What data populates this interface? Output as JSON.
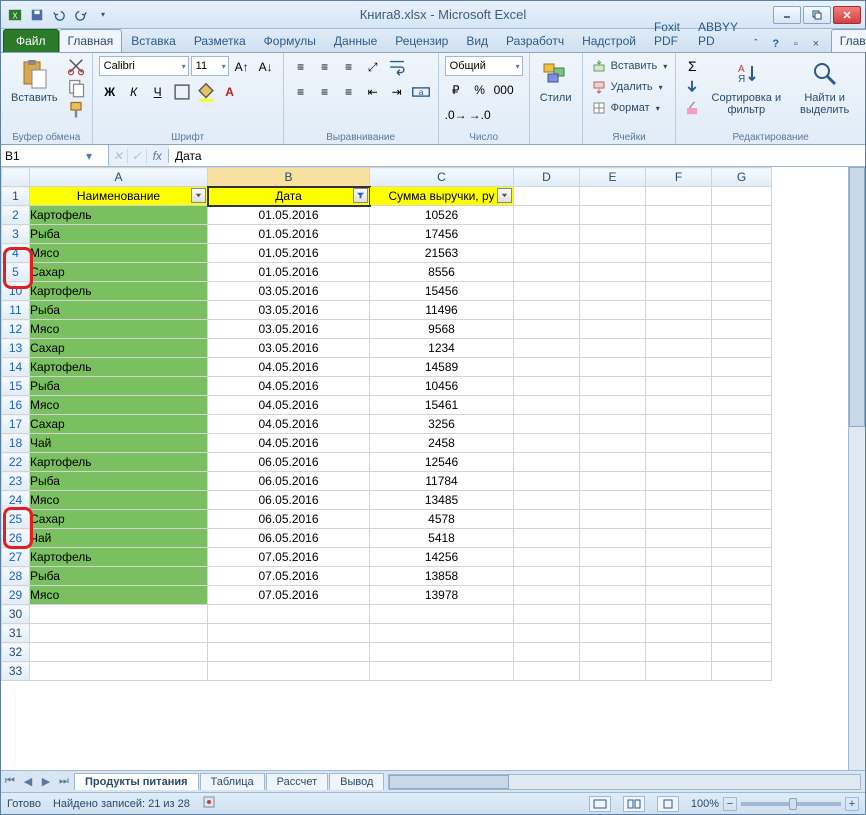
{
  "window": {
    "title": "Книга8.xlsx - Microsoft Excel"
  },
  "tabs": {
    "file": "Файл",
    "items": [
      "Главная",
      "Вставка",
      "Разметка",
      "Формулы",
      "Данные",
      "Рецензир",
      "Вид",
      "Разработч",
      "Надстрой",
      "Foxit PDF",
      "ABBYY PD"
    ],
    "active": 0
  },
  "ribbon": {
    "clipboard": {
      "paste": "Вставить",
      "label": "Буфер обмена"
    },
    "font": {
      "name": "Calibri",
      "size": "11",
      "label": "Шрифт"
    },
    "align": {
      "label": "Выравнивание"
    },
    "number": {
      "format": "Общий",
      "label": "Число"
    },
    "styles": {
      "btn": "Стили",
      "label": ""
    },
    "cells": {
      "insert": "Вставить",
      "delete": "Удалить",
      "format": "Формат",
      "label": "Ячейки"
    },
    "editing": {
      "sort": "Сортировка и фильтр",
      "find": "Найти и выделить",
      "label": "Редактирование"
    }
  },
  "namebox": "B1",
  "formula": "Дата",
  "columns": {
    "A": 178,
    "B": 162,
    "C": 144,
    "D": 66,
    "E": 66,
    "F": 66,
    "G": 66
  },
  "headers": {
    "A": "Наименование",
    "B": "Дата",
    "C": "Сумма выручки, ру"
  },
  "rows": [
    {
      "n": 2,
      "a": "Картофель",
      "b": "01.05.2016",
      "c": "10526"
    },
    {
      "n": 3,
      "a": "Рыба",
      "b": "01.05.2016",
      "c": "17456"
    },
    {
      "n": 4,
      "a": "Мясо",
      "b": "01.05.2016",
      "c": "21563"
    },
    {
      "n": 5,
      "a": "Сахар",
      "b": "01.05.2016",
      "c": "8556"
    },
    {
      "n": 10,
      "a": "Картофель",
      "b": "03.05.2016",
      "c": "15456"
    },
    {
      "n": 11,
      "a": "Рыба",
      "b": "03.05.2016",
      "c": "11496"
    },
    {
      "n": 12,
      "a": "Мясо",
      "b": "03.05.2016",
      "c": "9568"
    },
    {
      "n": 13,
      "a": "Сахар",
      "b": "03.05.2016",
      "c": "1234"
    },
    {
      "n": 14,
      "a": "Картофель",
      "b": "04.05.2016",
      "c": "14589"
    },
    {
      "n": 15,
      "a": "Рыба",
      "b": "04.05.2016",
      "c": "10456"
    },
    {
      "n": 16,
      "a": "Мясо",
      "b": "04.05.2016",
      "c": "15461"
    },
    {
      "n": 17,
      "a": "Сахар",
      "b": "04.05.2016",
      "c": "3256"
    },
    {
      "n": 18,
      "a": "Чай",
      "b": "04.05.2016",
      "c": "2458"
    },
    {
      "n": 22,
      "a": "Картофель",
      "b": "06.05.2016",
      "c": "12546"
    },
    {
      "n": 23,
      "a": "Рыба",
      "b": "06.05.2016",
      "c": "11784"
    },
    {
      "n": 24,
      "a": "Мясо",
      "b": "06.05.2016",
      "c": "13485"
    },
    {
      "n": 25,
      "a": "Сахар",
      "b": "06.05.2016",
      "c": "4578"
    },
    {
      "n": 26,
      "a": "Чай",
      "b": "06.05.2016",
      "c": "5418"
    },
    {
      "n": 27,
      "a": "Картофель",
      "b": "07.05.2016",
      "c": "14256"
    },
    {
      "n": 28,
      "a": "Рыба",
      "b": "07.05.2016",
      "c": "13858"
    },
    {
      "n": 29,
      "a": "Мясо",
      "b": "07.05.2016",
      "c": "13978"
    }
  ],
  "emptyRows": [
    30,
    31,
    32,
    33
  ],
  "sheets": {
    "items": [
      "Продукты питания",
      "Таблица",
      "Рассчет",
      "Вывод"
    ],
    "active": 0
  },
  "status": {
    "ready": "Готово",
    "found": "Найдено записей: 21 из 28",
    "zoom": "100%"
  }
}
